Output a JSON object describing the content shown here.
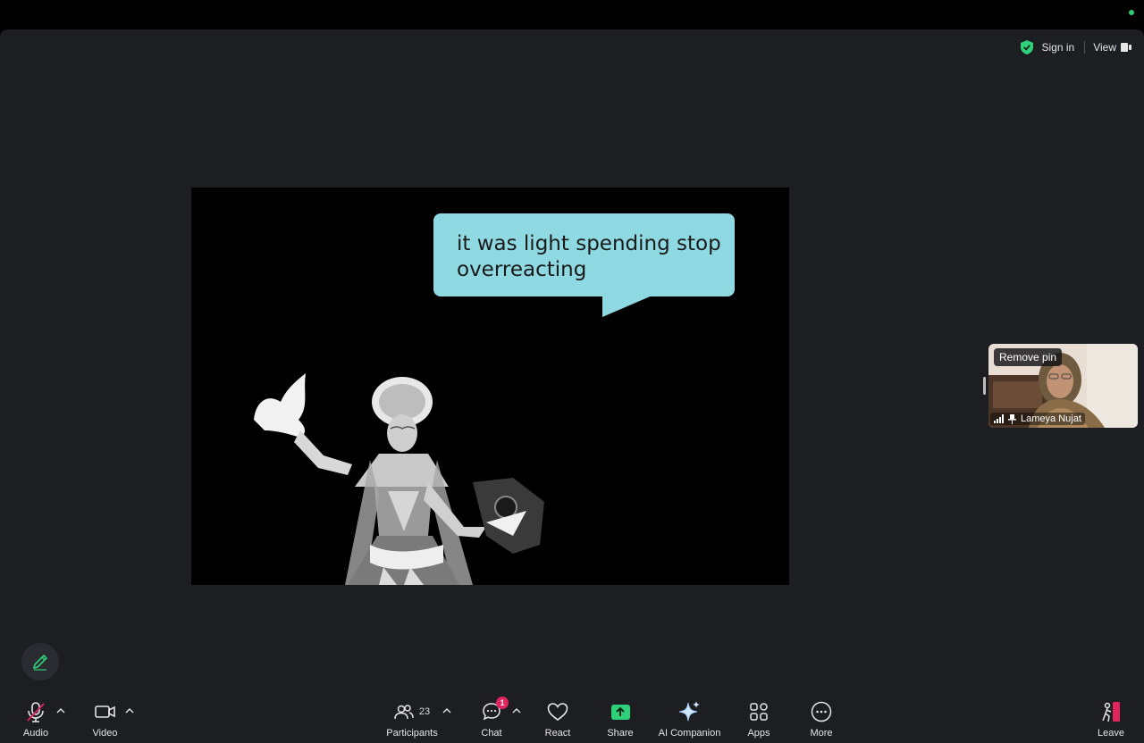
{
  "header": {
    "sign_in": "Sign in",
    "view": "View"
  },
  "share": {
    "bubble_text": "it was light spending stop overreacting"
  },
  "pinned_tile": {
    "remove_pin": "Remove pin",
    "name": "Lameya Nujat"
  },
  "toolbar": {
    "audio": "Audio",
    "video": "Video",
    "participants": "Participants",
    "participants_count": "23",
    "chat": "Chat",
    "chat_badge": "1",
    "react": "React",
    "share": "Share",
    "ai_companion": "AI Companion",
    "apps": "Apps",
    "more": "More",
    "leave": "Leave"
  },
  "colors": {
    "accent_green": "#2fd07a",
    "badge_red": "#e0245e",
    "bubble": "#8fd9e2",
    "leave_red": "#e0245e"
  },
  "icons": [
    "shield-check-icon",
    "view-icon",
    "microphone-muted-icon",
    "video-camera-icon",
    "participants-icon",
    "chat-icon",
    "heart-icon",
    "share-screen-icon",
    "sparkle-icon",
    "apps-icon",
    "more-icon",
    "leave-icon",
    "pencil-icon",
    "signal-icon",
    "pin-icon"
  ]
}
